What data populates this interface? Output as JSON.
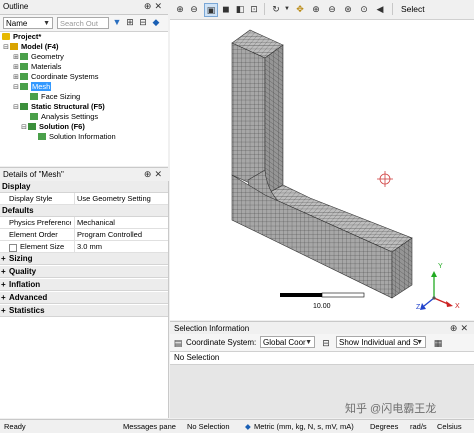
{
  "outline": {
    "title": "Outline",
    "name_combo": "Name",
    "search_placeholder": "Search Out",
    "tree": {
      "project": "Project*",
      "model": "Model (F4)",
      "geometry": "Geometry",
      "materials": "Materials",
      "coordinate_systems": "Coordinate Systems",
      "mesh": "Mesh",
      "face_sizing": "Face Sizing",
      "static_structural": "Static Structural (F5)",
      "analysis_settings": "Analysis Settings",
      "solution": "Solution (F6)",
      "solution_information": "Solution Information"
    }
  },
  "details": {
    "title": "Details of \"Mesh\"",
    "sections": {
      "display": "Display",
      "defaults": "Defaults",
      "sizing": "Sizing",
      "quality": "Quality",
      "inflation": "Inflation",
      "advanced": "Advanced",
      "statistics": "Statistics"
    },
    "rows": {
      "display_style_label": "Display Style",
      "display_style_value": "Use Geometry Setting",
      "physics_label": "Physics Preference",
      "physics_value": "Mechanical",
      "element_order_label": "Element Order",
      "element_order_value": "Program Controlled",
      "element_size_label": "Element Size",
      "element_size_value": "3.0 mm"
    }
  },
  "toolbar": {
    "select_label": "Select"
  },
  "viewport": {
    "scale_max": "10.00",
    "axis_y": "Y",
    "axis_z": "Z",
    "axis_x": "X"
  },
  "selection_info": {
    "title": "Selection Information",
    "coord_label": "Coordinate System:",
    "coord_value": "Global Coor",
    "show_value": "Show Individual and S",
    "status": "No Selection"
  },
  "statusbar": {
    "ready": "Ready",
    "messages": "Messages pane",
    "no_selection": "No Selection",
    "units": "Metric (mm, kg, N, s, mV, mA)",
    "degrees": "Degrees",
    "rads": "rad/s",
    "celsius": "Celsius"
  },
  "watermark": "知乎 @闪电霸王龙",
  "colors": {
    "selection_blue": "#3399ff",
    "mesh_face": "#a7a7a7",
    "mesh_line": "#3a3a3a",
    "axis_x": "#cc2222",
    "axis_y": "#22aa22",
    "axis_z": "#2244cc"
  }
}
